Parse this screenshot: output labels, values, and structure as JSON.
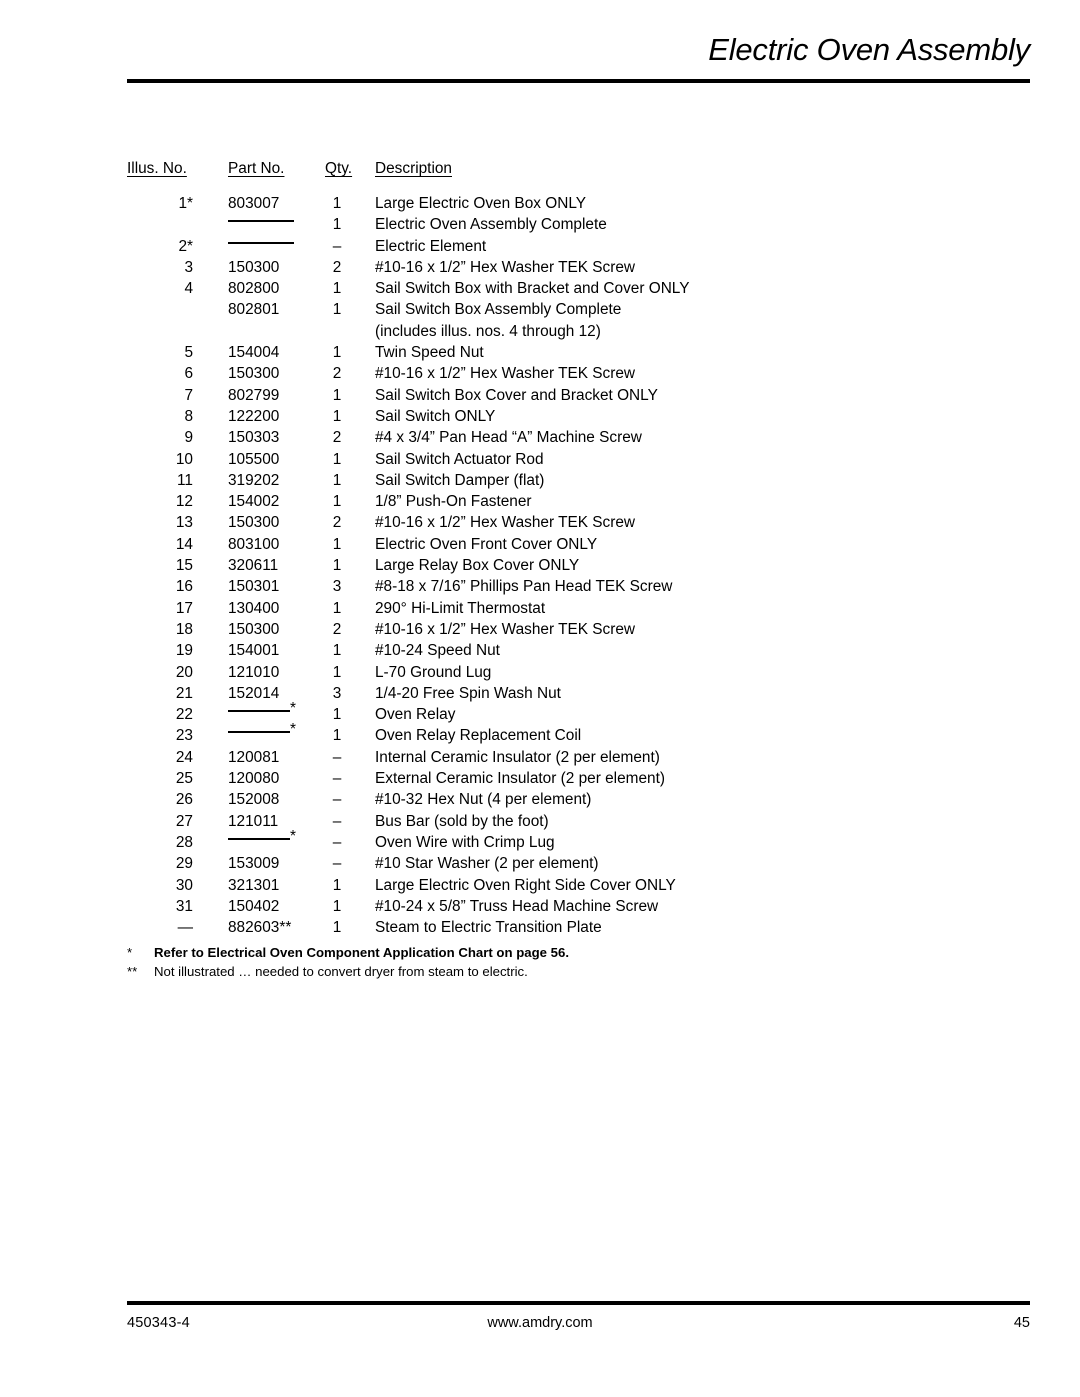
{
  "header": {
    "title": "Electric Oven Assembly"
  },
  "table": {
    "columns": {
      "illus": "Illus. No.",
      "part": "Part No.",
      "qty": "Qty.",
      "desc": "Description"
    },
    "rows": [
      {
        "illus": "1*",
        "part": "803007",
        "part_dash": false,
        "qty": "1",
        "desc": "Large Electric Oven Box ONLY"
      },
      {
        "illus": "",
        "part": "",
        "part_dash": true,
        "part_dash_star": false,
        "qty": "1",
        "desc": "Electric Oven Assembly Complete"
      },
      {
        "illus": "2*",
        "part": "",
        "part_dash": true,
        "part_dash_star": false,
        "qty": "–",
        "desc": "Electric Element"
      },
      {
        "illus": "3",
        "part": "150300",
        "part_dash": false,
        "qty": "2",
        "desc": "#10-16 x 1/2” Hex Washer TEK Screw"
      },
      {
        "illus": "4",
        "part": "802800",
        "part_dash": false,
        "qty": "1",
        "desc": "Sail Switch Box with Bracket and Cover ONLY"
      },
      {
        "illus": "",
        "part": "802801",
        "part_dash": false,
        "qty": "1",
        "desc": "Sail Switch Box Assembly Complete"
      },
      {
        "illus": "",
        "part": "",
        "part_dash": false,
        "qty": "",
        "desc": "(includes illus. nos. 4 through 12)"
      },
      {
        "illus": "5",
        "part": "154004",
        "part_dash": false,
        "qty": "1",
        "desc": "Twin Speed Nut"
      },
      {
        "illus": "6",
        "part": "150300",
        "part_dash": false,
        "qty": "2",
        "desc": "#10-16 x 1/2” Hex Washer TEK Screw"
      },
      {
        "illus": "7",
        "part": "802799",
        "part_dash": false,
        "qty": "1",
        "desc": "Sail Switch Box Cover and Bracket ONLY"
      },
      {
        "illus": "8",
        "part": "122200",
        "part_dash": false,
        "qty": "1",
        "desc": "Sail Switch ONLY"
      },
      {
        "illus": "9",
        "part": "150303",
        "part_dash": false,
        "qty": "2",
        "desc": "#4 x 3/4” Pan Head “A” Machine Screw"
      },
      {
        "illus": "10",
        "part": "105500",
        "part_dash": false,
        "qty": "1",
        "desc": "Sail Switch Actuator Rod"
      },
      {
        "illus": "11",
        "part": "319202",
        "part_dash": false,
        "qty": "1",
        "desc": "Sail Switch Damper (flat)"
      },
      {
        "illus": "12",
        "part": "154002",
        "part_dash": false,
        "qty": "1",
        "desc": "1/8” Push-On Fastener"
      },
      {
        "illus": "13",
        "part": "150300",
        "part_dash": false,
        "qty": "2",
        "desc": "#10-16 x 1/2” Hex Washer TEK Screw"
      },
      {
        "illus": "14",
        "part": "803100",
        "part_dash": false,
        "qty": "1",
        "desc": "Electric Oven Front Cover ONLY"
      },
      {
        "illus": "15",
        "part": "320611",
        "part_dash": false,
        "qty": "1",
        "desc": "Large Relay Box Cover ONLY"
      },
      {
        "illus": "16",
        "part": "150301",
        "part_dash": false,
        "qty": "3",
        "desc": "#8-18 x 7/16” Phillips Pan Head TEK Screw"
      },
      {
        "illus": "17",
        "part": "130400",
        "part_dash": false,
        "qty": "1",
        "desc": "290° Hi-Limit Thermostat"
      },
      {
        "illus": "18",
        "part": "150300",
        "part_dash": false,
        "qty": "2",
        "desc": "#10-16 x 1/2” Hex Washer TEK Screw"
      },
      {
        "illus": "19",
        "part": "154001",
        "part_dash": false,
        "qty": "1",
        "desc": "#10-24 Speed Nut"
      },
      {
        "illus": "20",
        "part": "121010",
        "part_dash": false,
        "qty": "1",
        "desc": "L-70 Ground Lug"
      },
      {
        "illus": "21",
        "part": "152014",
        "part_dash": false,
        "qty": "3",
        "desc": "1/4-20 Free Spin Wash Nut"
      },
      {
        "illus": "22",
        "part": "",
        "part_dash": true,
        "part_dash_star": true,
        "qty": "1",
        "desc": "Oven Relay"
      },
      {
        "illus": "23",
        "part": "",
        "part_dash": true,
        "part_dash_star": true,
        "qty": "1",
        "desc": "Oven Relay Replacement Coil"
      },
      {
        "illus": "24",
        "part": "120081",
        "part_dash": false,
        "qty": "–",
        "desc": "Internal Ceramic Insulator (2 per element)"
      },
      {
        "illus": "25",
        "part": "120080",
        "part_dash": false,
        "qty": "–",
        "desc": "External Ceramic Insulator (2 per element)"
      },
      {
        "illus": "26",
        "part": "152008",
        "part_dash": false,
        "qty": "–",
        "desc": "#10-32 Hex Nut (4 per element)"
      },
      {
        "illus": "27",
        "part": "121011",
        "part_dash": false,
        "qty": "–",
        "desc": "Bus Bar (sold by the foot)"
      },
      {
        "illus": "28",
        "part": "",
        "part_dash": true,
        "part_dash_star": true,
        "qty": "–",
        "desc": "Oven Wire with Crimp Lug"
      },
      {
        "illus": "29",
        "part": "153009",
        "part_dash": false,
        "qty": "–",
        "desc": "#10 Star Washer (2 per element)"
      },
      {
        "illus": "30",
        "part": "321301",
        "part_dash": false,
        "qty": "1",
        "desc": "Large Electric Oven Right Side Cover ONLY"
      },
      {
        "illus": "31",
        "part": "150402",
        "part_dash": false,
        "qty": "1",
        "desc": "#10-24 x 5/8” Truss Head Machine Screw"
      },
      {
        "illus": "—",
        "part": "882603**",
        "part_dash": false,
        "qty": "1",
        "desc": "Steam to Electric Transition Plate"
      }
    ]
  },
  "footnotes": [
    {
      "marker": "*",
      "text": "Refer to Electrical Oven Component Application Chart on page 56.",
      "bold": true
    },
    {
      "marker": "**",
      "text": "Not illustrated … needed to convert dryer from steam to electric.",
      "bold": false
    }
  ],
  "footer": {
    "left": "450343‑4",
    "center": "www.amdry.com",
    "right": "45"
  }
}
